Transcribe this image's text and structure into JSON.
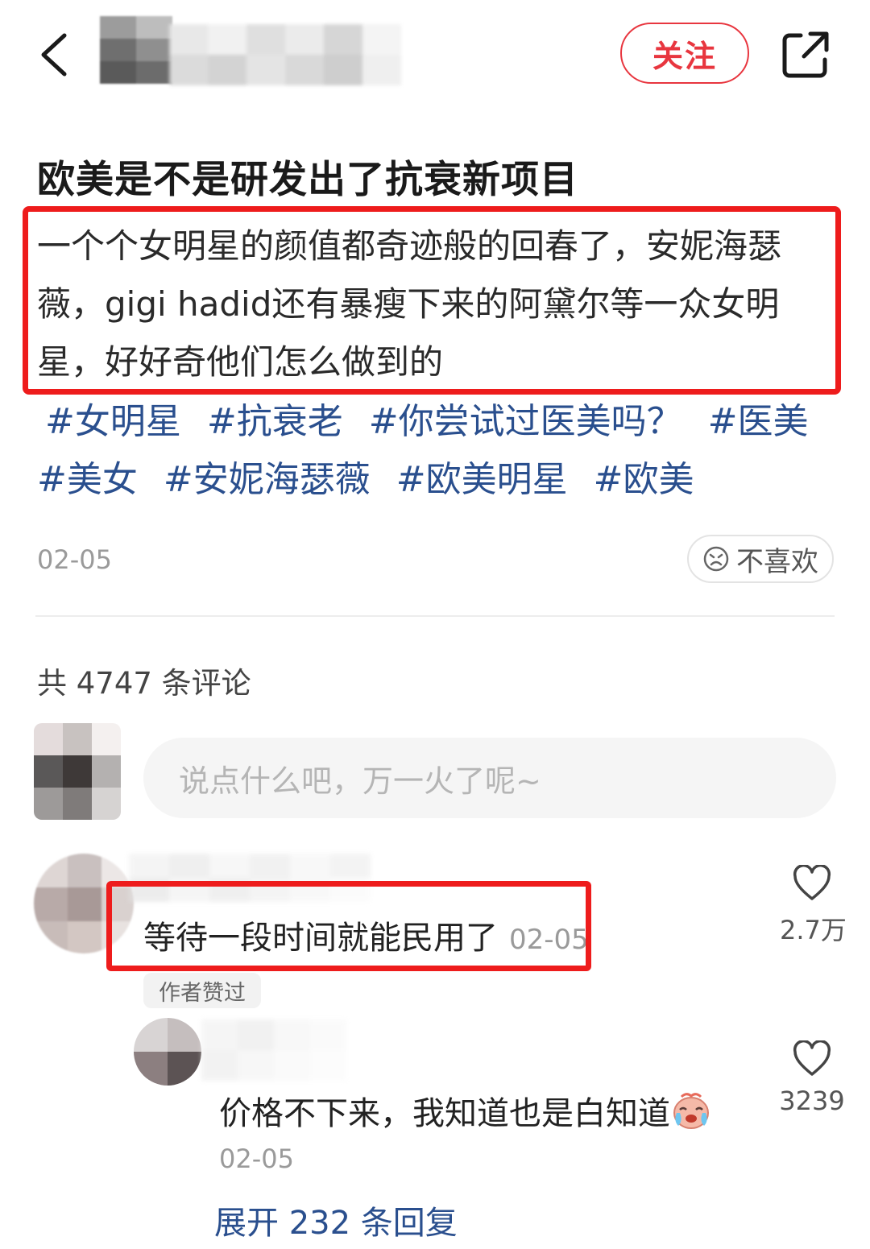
{
  "header": {
    "back_icon": "chevron-left-icon",
    "follow_label": "关注",
    "share_icon": "share-external-icon",
    "accent_color": "#e8363f"
  },
  "post": {
    "title": "欧美是不是研发出了抗衰新项目",
    "body": "一个个女明星的颜值都奇迹般的回春了，安妮海瑟薇，gigi hadid还有暴瘦下来的阿黛尔等一众女明星，好好奇他们怎么做到的",
    "tags": [
      "#女明星",
      "#抗衰老",
      "#你尝试过医美吗？",
      "#医美",
      "#美女",
      "#安妮海瑟薇",
      "#欧美明星",
      "#欧美"
    ],
    "date": "02-05",
    "dislike_label": "不喜欢",
    "tag_color": "#2a4f8e"
  },
  "comments": {
    "count_label": "共 4747 条评论",
    "input_placeholder": "说点什么吧，万一火了呢~",
    "items": [
      {
        "text": "等待一段时间就能民用了",
        "date": "02-05",
        "badge": "作者赞过",
        "likes": "2.7万",
        "replies": [
          {
            "text": "价格不下来，我知道也是白知道",
            "emoji": "crying-face-emoji",
            "date": "02-05",
            "likes": "3239"
          }
        ],
        "expand_label": "展开 232 条回复"
      }
    ]
  }
}
